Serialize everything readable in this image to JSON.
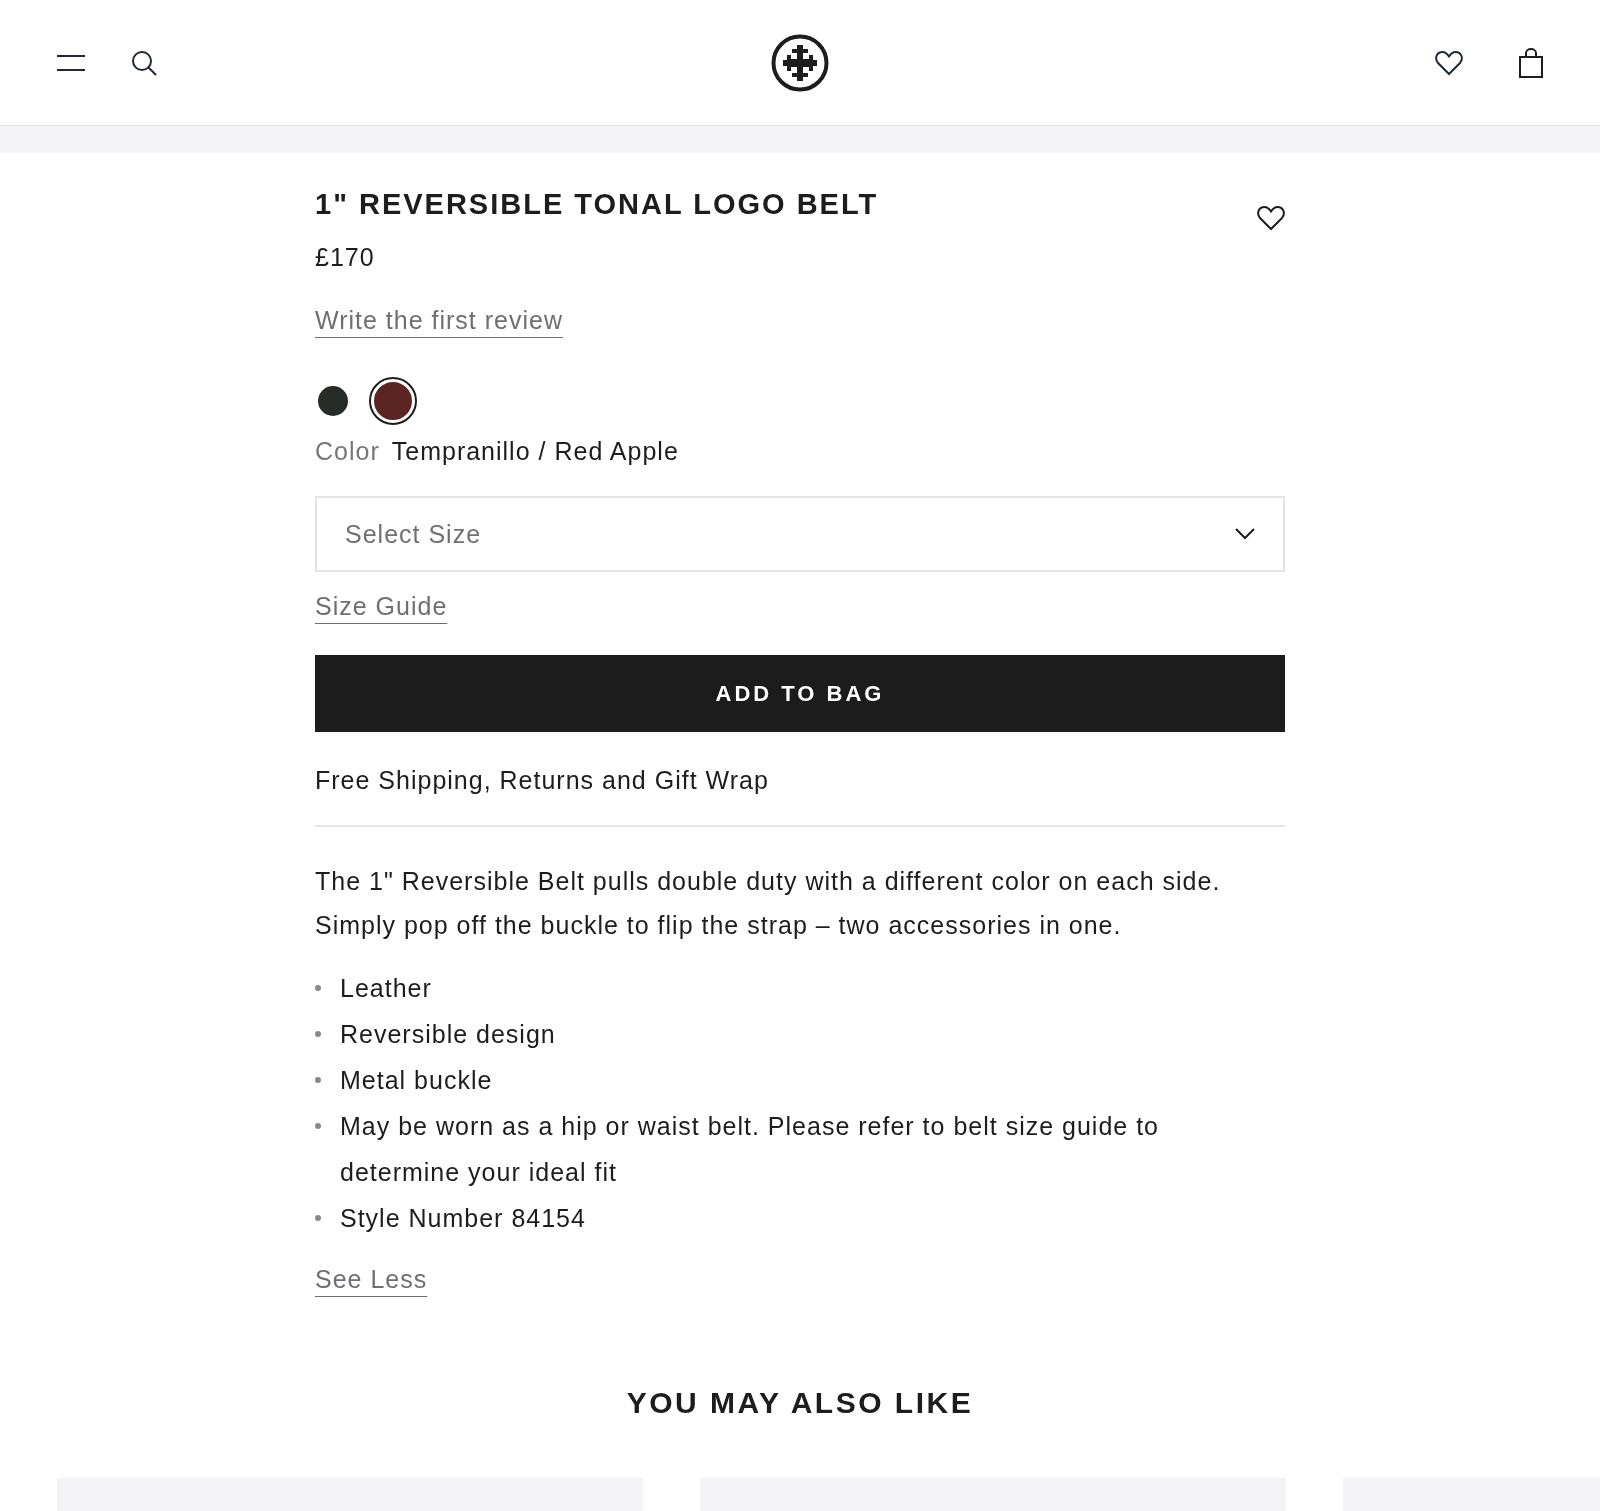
{
  "product": {
    "title": "1\" REVERSIBLE TONAL LOGO BELT",
    "price": "£170",
    "review_link": "Write the first review",
    "swatches": [
      {
        "color": "#262d28",
        "selected": false
      },
      {
        "color": "#5a2522",
        "selected": true
      }
    ],
    "color_label": "Color",
    "color_value": "Tempranillo / Red Apple",
    "size_select": {
      "placeholder": "Select Size"
    },
    "size_guide": "Size Guide",
    "add_to_bag": "ADD TO BAG",
    "shipping": "Free Shipping, Returns and Gift Wrap",
    "description": "The 1\" Reversible Belt pulls double duty with a different color on each side. Simply pop off the buckle to flip the strap – two accessories in one.",
    "features": [
      "Leather",
      "Reversible design",
      "Metal buckle",
      "May be worn as a hip or waist belt. Please refer to belt size guide to determine your ideal fit",
      "Style Number 84154"
    ],
    "see_less": "See Less"
  },
  "recommendations": {
    "heading": "YOU MAY ALSO LIKE"
  }
}
